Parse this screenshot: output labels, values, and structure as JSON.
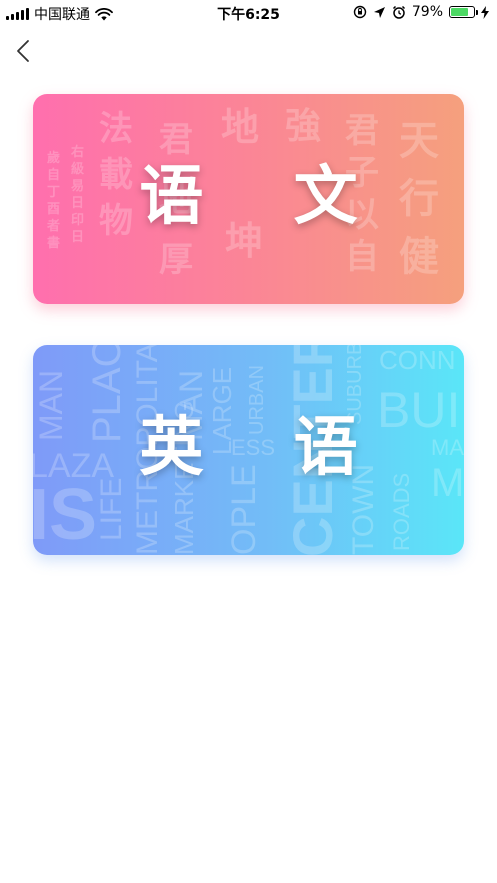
{
  "status_bar": {
    "carrier": "中国联通",
    "time": "下午6:25",
    "battery_percent": "79%",
    "battery_level": 0.79,
    "battery_color": "#4cd964"
  },
  "nav": {
    "back_icon": "chevron-left-icon"
  },
  "subjects": [
    {
      "title": "语 文",
      "gradient": [
        "#ff6fae",
        "#f5a07d"
      ],
      "deco": {
        "c1": "法載物",
        "c2": "君地厚",
        "c3": "地",
        "c4": "坤",
        "c5": "強",
        "c6": "君子以自",
        "c7": "天行健",
        "small1": "右級易日印日",
        "small2": "歲自丁酉者書"
      }
    },
    {
      "title": "英 语",
      "gradient": [
        "#7f9af8",
        "#5ae6f8"
      ],
      "deco": {
        "w1": "MAN",
        "w2": "PLAC",
        "w3": "LAZA",
        "w4": "IS",
        "w5": "LIFE",
        "w6": "METROPOLITAN",
        "w7": "MARKETING",
        "w8": "MAN",
        "w9": "LARGE",
        "w10": "OPLE",
        "w11": "URBAN",
        "w12": "CENTER",
        "w13": "SUBURBS",
        "w14": "TOWN",
        "w15": "CONN",
        "w16": "BUIL",
        "w17": "ROADS",
        "w18": "MA",
        "w19": "M",
        "w20": "ESS"
      }
    }
  ]
}
